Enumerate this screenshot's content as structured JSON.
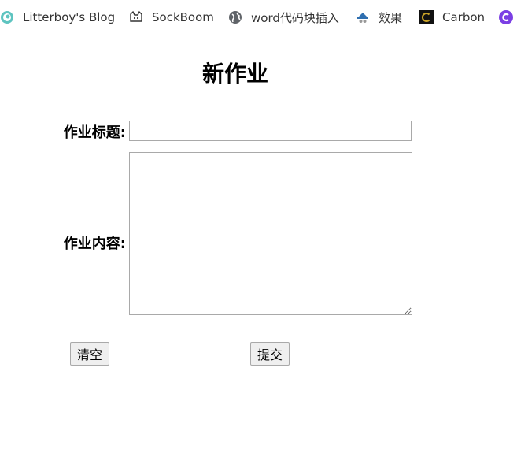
{
  "bookmarks": [
    {
      "label": "Litterboy's Blog",
      "icon": "swirl-logo-icon",
      "color": "#3aa7a0"
    },
    {
      "label": "SockBoom",
      "icon": "sockboom-cat-icon",
      "color": "#333333"
    },
    {
      "label": "word代码块插入",
      "icon": "globe-icon",
      "color": "#555555"
    },
    {
      "label": "效果",
      "icon": "hat-logo-icon",
      "color": "#2f6fb0"
    },
    {
      "label": "Carbon",
      "icon": "carbon-logo-icon",
      "color": "#000000"
    },
    {
      "label": "",
      "icon": "purple-c-logo-icon",
      "color": "#7b3fe4"
    }
  ],
  "form": {
    "heading": "新作业",
    "title_label": "作业标题:",
    "title_value": "",
    "content_label": "作业内容:",
    "content_value": "",
    "clear_button": "清空",
    "submit_button": "提交"
  }
}
